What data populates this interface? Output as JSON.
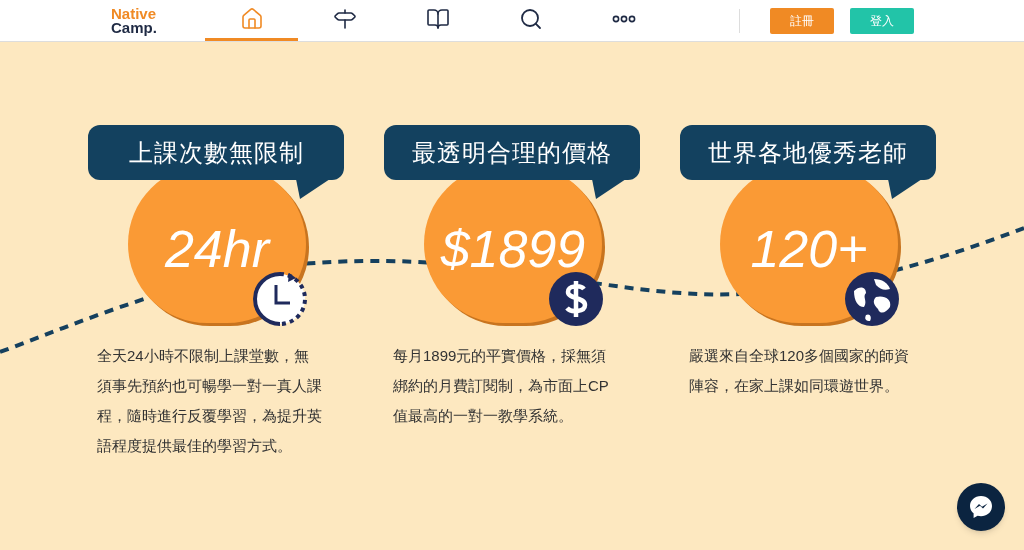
{
  "logo": {
    "first": "Native",
    "second": "Camp."
  },
  "nav": [
    {
      "kind": "home",
      "selected": true
    },
    {
      "kind": "signpost",
      "selected": false
    },
    {
      "kind": "book",
      "selected": false
    },
    {
      "kind": "search",
      "selected": false
    },
    {
      "kind": "more",
      "selected": false
    }
  ],
  "buttons": [
    {
      "label": "註冊",
      "kind": "signup"
    },
    {
      "label": "登入",
      "kind": "login"
    }
  ],
  "features": [
    {
      "title": "上課次數無限制",
      "stat": "24hr",
      "kind": "clock",
      "description": "全天24小時不限制上課堂數，無須事先預約也可暢學一對一真人課程，隨時進行反覆學習，為提升英語程度提供最佳的學習方式。"
    },
    {
      "title": "最透明合理的價格",
      "stat": "$1899",
      "kind": "dollar",
      "description": "每月1899元的平實價格，採無須綁約的月費訂閱制，為市面上CP值最高的一對一教學系統。"
    },
    {
      "title": "世界各地優秀老師",
      "stat": "120+",
      "kind": "globe",
      "description": "嚴選來自全球120多個國家的師資陣容，在家上課如同環遊世界。"
    }
  ]
}
